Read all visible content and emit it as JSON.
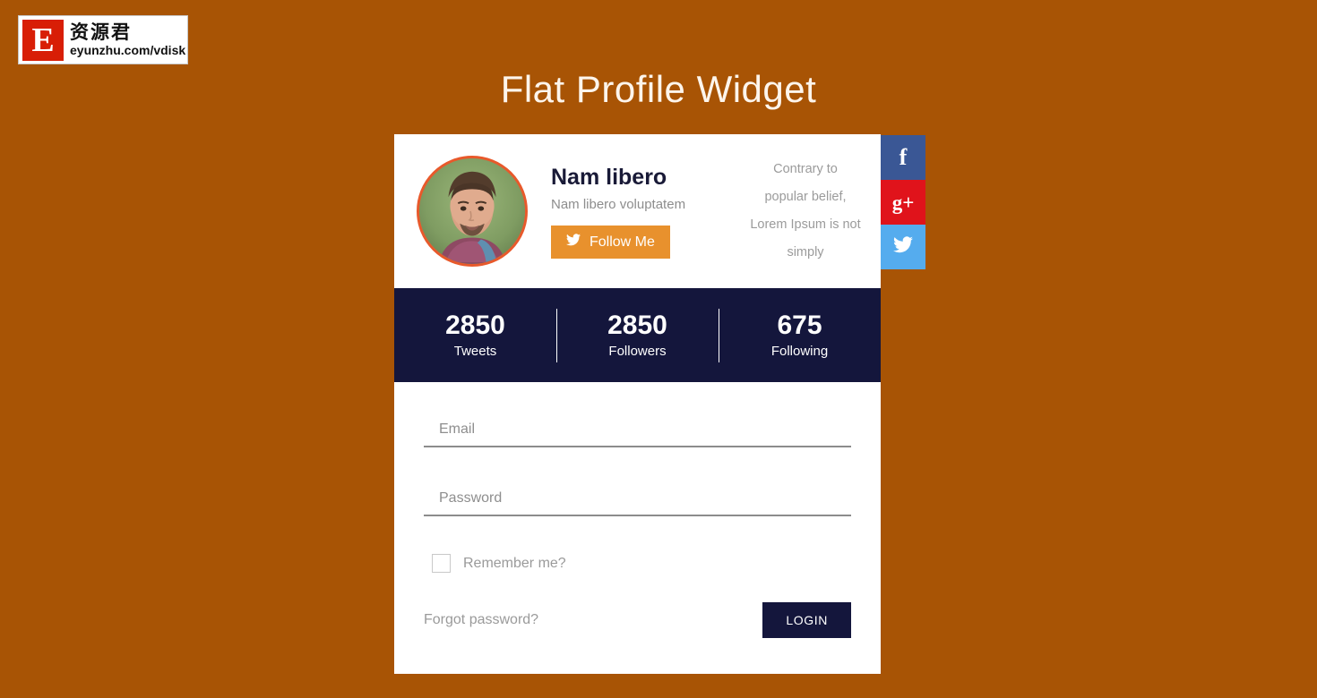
{
  "page": {
    "title": "Flat Profile Widget",
    "background_color": "#a85405"
  },
  "watermark": {
    "badge_letter": "E",
    "cn_text": "资源君",
    "url_text": "eyunzhu.com/vdisk"
  },
  "profile": {
    "name": "Nam libero",
    "subtitle": "Nam libero voluptatem",
    "follow_button": "Follow Me",
    "follow_icon": "twitter-bird-icon",
    "quote": "Contrary to popular belief, Lorem Ipsum is not simply",
    "avatar_alt": "avatar-photo",
    "accent_color": "#e8912d",
    "avatar_ring_color": "#e8592b"
  },
  "stats": {
    "items": [
      {
        "value": "2850",
        "label": "Tweets"
      },
      {
        "value": "2850",
        "label": "Followers"
      },
      {
        "value": "675",
        "label": "Following"
      }
    ],
    "background_color": "#14163c"
  },
  "login": {
    "email_placeholder": "Email",
    "email_value": "",
    "password_placeholder": "Password",
    "password_value": "",
    "remember_label": "Remember me?",
    "remember_checked": false,
    "forgot_label": "Forgot password?",
    "submit_label": "LOGIN"
  },
  "social": {
    "items": [
      {
        "name": "facebook",
        "glyph": "f",
        "color": "#3a5795"
      },
      {
        "name": "googleplus",
        "glyph": "g+",
        "color": "#e0131b"
      },
      {
        "name": "twitter",
        "glyph": "twitter-bird-icon",
        "color": "#55acee"
      }
    ]
  }
}
